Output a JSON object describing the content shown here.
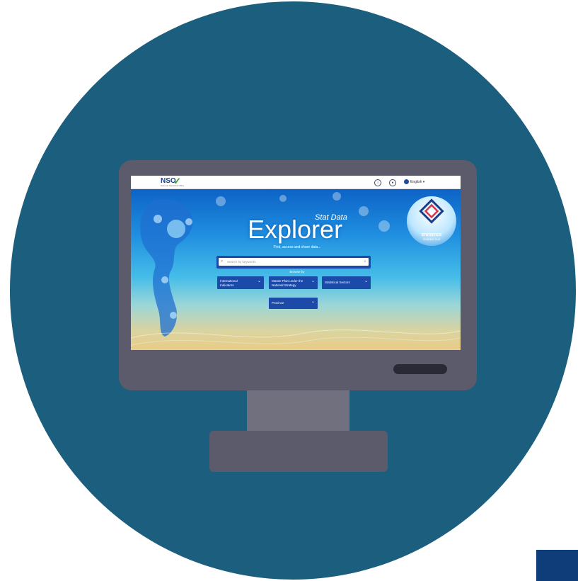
{
  "header": {
    "logo_text": "NSO",
    "logo_sub": "National Statistical Office",
    "language": "English"
  },
  "hero": {
    "title": "Explorer",
    "subtitle": "Stat Data",
    "tagline": "Find, access and share data...",
    "hub_title": "STATISTICS",
    "hub_subtitle": "SHARING HUB"
  },
  "search": {
    "placeholder": "Search by keywords"
  },
  "browse": {
    "label": "Browse by",
    "buttons": [
      {
        "label": "International Indicators"
      },
      {
        "label": "Master Plan under the National Strategy"
      },
      {
        "label": "Statistical Sectors"
      },
      {
        "label": "Province"
      }
    ]
  },
  "colors": {
    "background_circle": "#1c5e7e",
    "monitor": "#5b5b6b",
    "button": "#1b4aa8"
  }
}
